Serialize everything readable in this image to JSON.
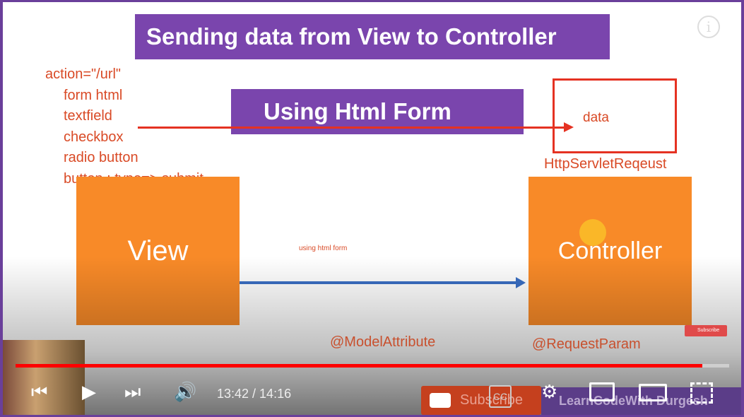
{
  "slide": {
    "title": "Sending data from View to Controller",
    "subtitle": "Using Html Form",
    "list": [
      "action=\"/url\"",
      "form html",
      "textfield",
      "checkbox",
      "radio button",
      "button : type=> submit"
    ],
    "data_box": "data",
    "http_label": "HttpServletReqeust",
    "view_label": "View",
    "controller_label": "Controller",
    "arrow_label": "using html form",
    "model_attribute": "@ModelAttribute",
    "request_param": "@RequestParam",
    "info_icon": "i"
  },
  "player": {
    "current_time": "13:42",
    "duration": "14:16",
    "time_display": "13:42 / 14:16",
    "progress_fraction": 0.962,
    "subscribe_small": "Subscribe",
    "subscribe_label": "Subscribe",
    "channel_watermark": "LearnCodeWith Durgesh",
    "cc_label": "CC",
    "accent": "#ff0000"
  }
}
